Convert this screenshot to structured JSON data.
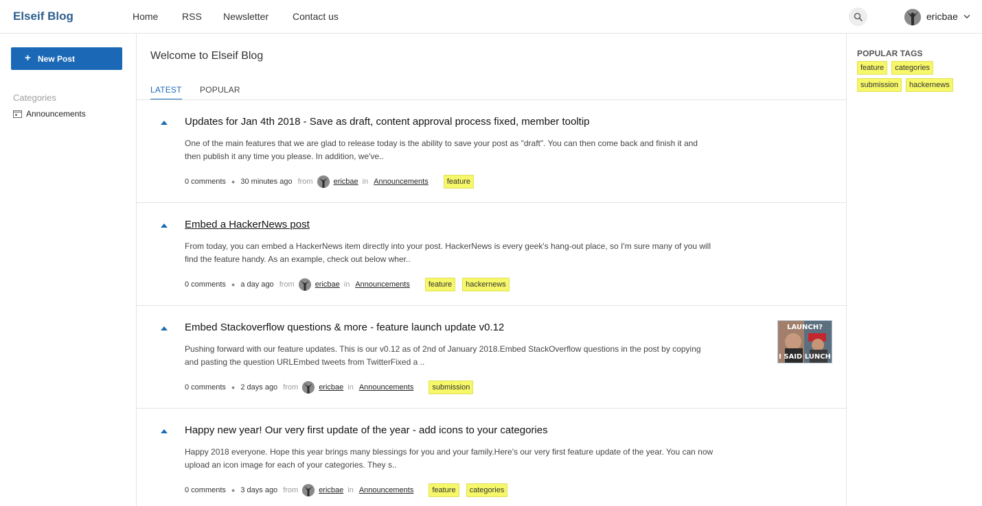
{
  "header": {
    "brand": "Elseif Blog",
    "nav": [
      "Home",
      "RSS",
      "Newsletter",
      "Contact us"
    ],
    "username": "ericbae"
  },
  "sidebar": {
    "new_post_label": "New Post",
    "categories_heading": "Categories",
    "categories": [
      "Announcements"
    ]
  },
  "main": {
    "welcome": "Welcome to Elseif Blog",
    "tabs": [
      {
        "label": "LATEST",
        "active": true
      },
      {
        "label": "POPULAR",
        "active": false
      }
    ],
    "posts": [
      {
        "title": "Updates for Jan 4th 2018 - Save as draft, content approval process fixed, member tooltip",
        "excerpt": "One of the main features that we are glad to release today is the ability to save your post as \"draft\". You can then come back and finish it and then publish it any time you please. In addition, we've..",
        "comments": "0 comments",
        "time": "30 minutes ago",
        "from": "from",
        "author": "ericbae",
        "in": "in",
        "category": "Announcements",
        "tags": [
          "feature"
        ]
      },
      {
        "title": "Embed a HackerNews post",
        "excerpt": "From today, you can embed a HackerNews item directly into your post. HackerNews is every geek's hang-out place, so I'm sure many of you will find the feature handy. As an example, check out below wher..",
        "comments": "0 comments",
        "time": "a day ago",
        "from": "from",
        "author": "ericbae",
        "in": "in",
        "category": "Announcements",
        "tags": [
          "feature",
          "hackernews"
        ]
      },
      {
        "title": "Embed Stackoverflow questions & more - feature launch update v0.12",
        "excerpt": "Pushing forward with our feature updates. This is our v0.12 as of 2nd of January 2018.Embed StackOverflow questions in the post by copying and pasting the question URLEmbed tweets from TwitterFixed a ..",
        "comments": "0 comments",
        "time": "2 days ago",
        "from": "from",
        "author": "ericbae",
        "in": "in",
        "category": "Announcements",
        "tags": [
          "submission"
        ],
        "thumbnail": {
          "top_text": "LAUNCH?",
          "bottom_text": "I SAID LUNCH"
        }
      },
      {
        "title": "Happy new year! Our very first update of the year - add icons to your categories",
        "excerpt": "Happy 2018 everyone. Hope this year brings many blessings for you and your family.Here's our very first feature update of the year. You can now upload an icon image for each of your categories. They s..",
        "comments": "0 comments",
        "time": "3 days ago",
        "from": "from",
        "author": "ericbae",
        "in": "in",
        "category": "Announcements",
        "tags": [
          "feature",
          "categories"
        ]
      }
    ]
  },
  "right": {
    "heading": "POPULAR TAGS",
    "tags": [
      "feature",
      "categories",
      "submission",
      "hackernews"
    ]
  },
  "colors": {
    "accent": "#1b69b6",
    "brand": "#2d5f8f",
    "tag_bg": "#f7f76a"
  },
  "icons": {
    "search": "search-icon",
    "chevron": "chevron-down-icon",
    "upvote": "upvote-arrow-icon",
    "category": "folder-icon",
    "plus": "plus-icon"
  }
}
